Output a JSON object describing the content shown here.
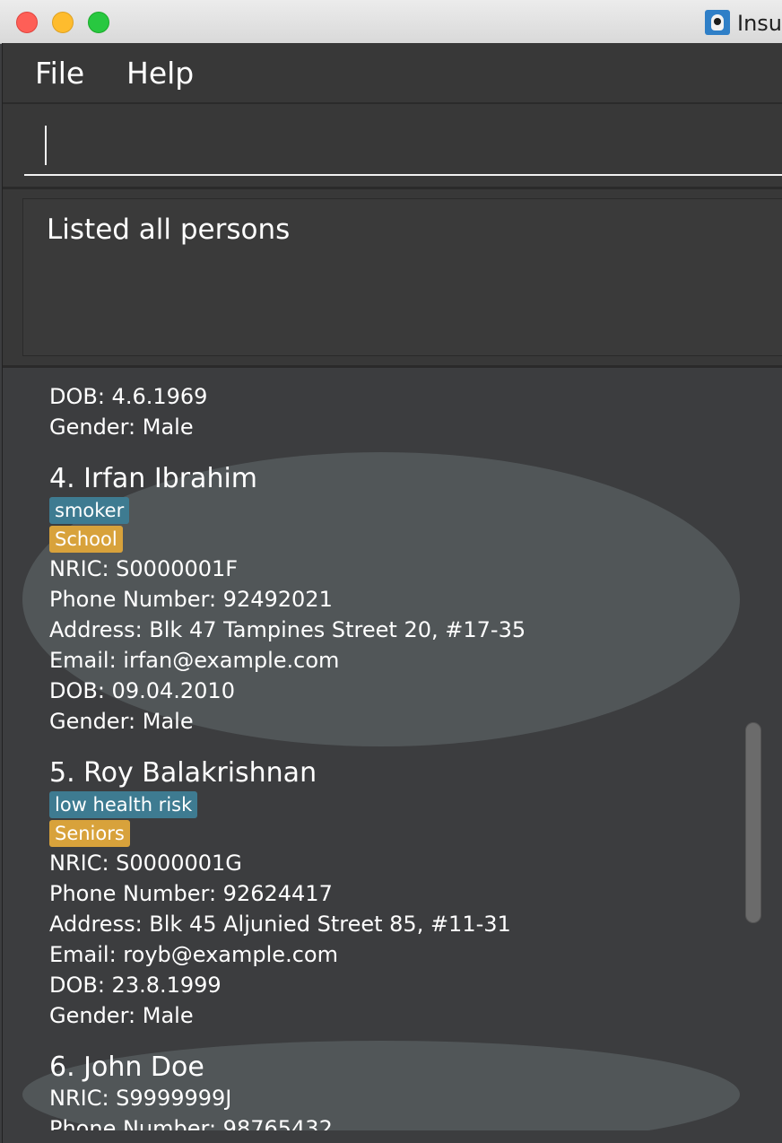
{
  "window": {
    "title": "Insu",
    "app_icon": "address-book-app-icon"
  },
  "menu": {
    "file_label": "File",
    "help_label": "Help"
  },
  "command_box": {
    "value": "",
    "placeholder": ""
  },
  "result_display": {
    "text": "Listed all persons"
  },
  "persons_partial": {
    "dob": "DOB: 4.6.1969",
    "gender": "Gender: Male"
  },
  "persons": [
    {
      "name": "4.  Irfan Ibrahim",
      "tags": [
        {
          "label": "smoker",
          "color": "#3e7b91"
        },
        {
          "label": "School",
          "color": "#d8a23b"
        }
      ],
      "nric": "NRIC: S0000001F",
      "phone": "Phone Number: 92492021",
      "address": "Address: Blk 47 Tampines Street 20, #17-35",
      "email": "Email: irfan@example.com",
      "dob": "DOB: 09.04.2010",
      "gender": "Gender: Male"
    },
    {
      "name": "5.  Roy Balakrishnan",
      "tags": [
        {
          "label": "low health risk",
          "color": "#3e7b91"
        },
        {
          "label": "Seniors",
          "color": "#d8a23b"
        }
      ],
      "nric": "NRIC: S0000001G",
      "phone": "Phone Number: 92624417",
      "address": "Address: Blk 45 Aljunied Street 85, #11-31",
      "email": "Email: royb@example.com",
      "dob": "DOB: 23.8.1999",
      "gender": "Gender: Male"
    },
    {
      "name": "6.  John Doe",
      "nric": "NRIC: S9999999J",
      "phone": "Phone Number: 98765432"
    }
  ],
  "colors": {
    "background": "#3c3d3f",
    "card_alt": "#515658",
    "tag_blue": "#3e7b91",
    "tag_orange": "#d8a23b"
  }
}
